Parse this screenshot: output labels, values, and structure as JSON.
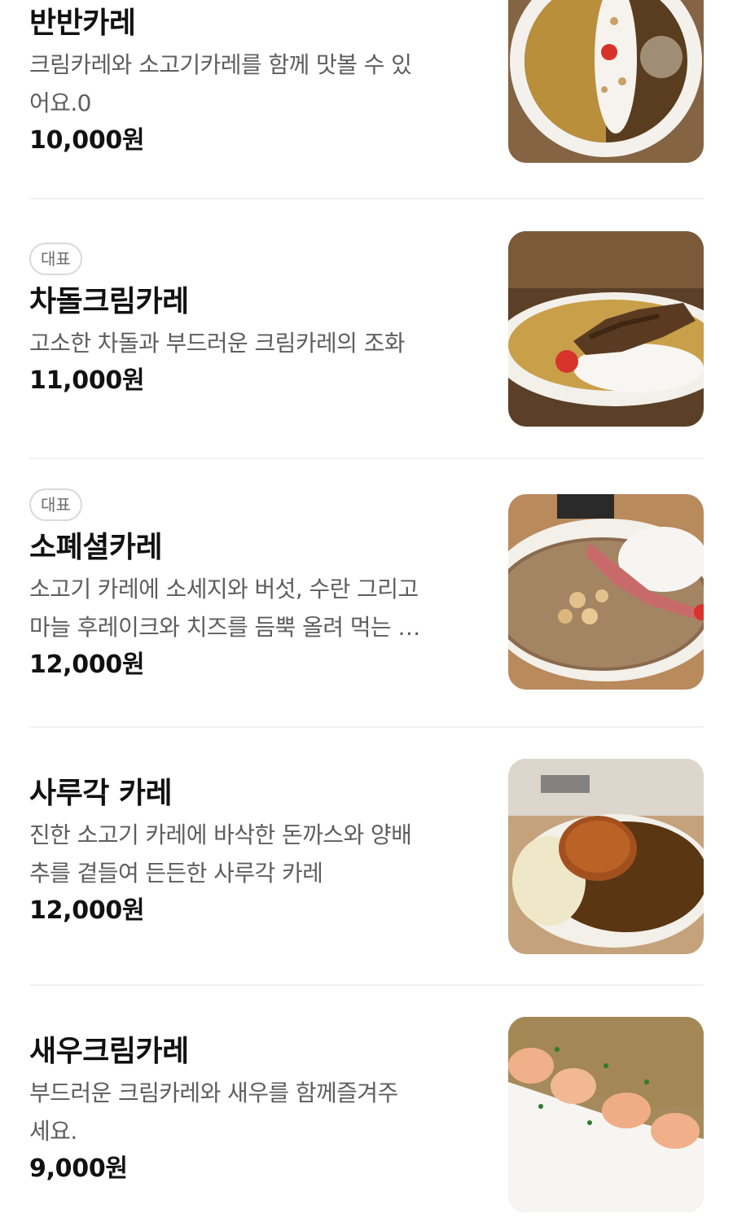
{
  "badge_label": "대표",
  "menu": [
    {
      "name": "반반카레",
      "description": "크림카레와 소고기카레를 함께 맛볼 수 있\n어요.0",
      "price": "10,000원",
      "image": "half-half-curry-photo"
    },
    {
      "name": "차돌크림카레",
      "description": "고소한 차돌과 부드러운 크림카레의 조화",
      "price": "11,000원",
      "image": "chadol-cream-curry-photo"
    },
    {
      "name": "소폐셜카레",
      "description": "소고기 카레에 소세지와 버섯, 수란 그리고\n마늘 후레이크와 치즈를 듬뿍 올려 먹는 …",
      "price": "12,000원",
      "image": "special-curry-photo"
    },
    {
      "name": "사루각 카레",
      "description": "진한 소고기 카레에 바삭한 돈까스와 양배\n추를 곁들여 든든한 사루각 카레",
      "price": "12,000원",
      "image": "katsu-curry-photo"
    },
    {
      "name": "새우크림카레",
      "description": "부드러운 크림카레와 새우를 함께즐겨주\n세요.",
      "price": "9,000원",
      "image": "shrimp-cream-curry-photo"
    }
  ]
}
